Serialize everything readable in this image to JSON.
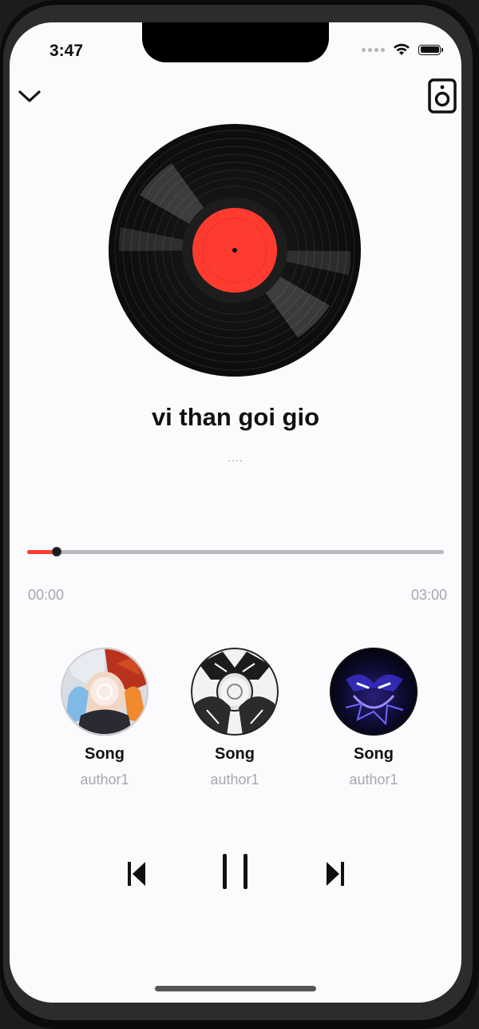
{
  "status_bar": {
    "time": "3:47"
  },
  "header": {
    "collapse_icon": "chevron-down-icon",
    "device_icon": "speaker-icon"
  },
  "now_playing": {
    "title": "vi than goi gio",
    "subtitle": "....",
    "artwork": "vinyl-record",
    "label_color": "#ff3b30"
  },
  "progress": {
    "elapsed": "00:00",
    "duration": "03:00",
    "fraction": 0.07,
    "accent_color": "#ff3b30"
  },
  "suggestions": [
    {
      "title": "Song",
      "author": "author1",
      "artwork": "anime-character-red-white-hair"
    },
    {
      "title": "Song",
      "author": "author1",
      "artwork": "anime-character-monochrome"
    },
    {
      "title": "Song",
      "author": "author1",
      "artwork": "dark-blue-glowing-figure"
    }
  ],
  "controls": {
    "previous_icon": "skip-previous-icon",
    "play_pause_icon": "pause-icon",
    "next_icon": "skip-next-icon"
  }
}
